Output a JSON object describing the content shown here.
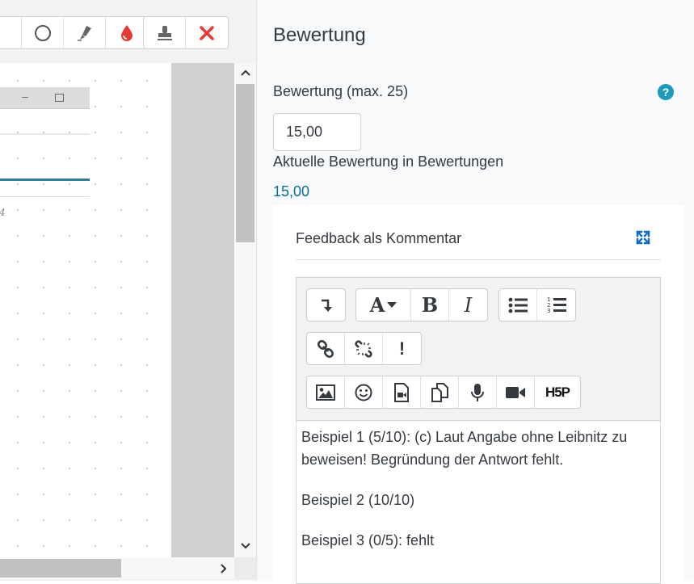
{
  "annotation_toolbar": {
    "group_a": [
      {
        "name": "partial-tool",
        "icon": "partial-icon"
      },
      {
        "name": "oval-tool",
        "icon": "circle-icon"
      },
      {
        "name": "pen-tool",
        "icon": "pen-icon"
      },
      {
        "name": "color-tool",
        "icon": "color-drop-icon",
        "color": "#e53935"
      }
    ],
    "group_b": [
      {
        "name": "stamp-tool",
        "icon": "stamp-icon"
      },
      {
        "name": "cross-stamp",
        "icon": "red-cross-icon",
        "color": "#e53935"
      }
    ]
  },
  "grading": {
    "heading": "Bewertung",
    "grade_label": "Bewertung (max. 25)",
    "grade_value": "15,00",
    "current_label": "Aktuelle Bewertung in Bewertungen",
    "current_value": "15,00",
    "help_icon": "?"
  },
  "feedback": {
    "title": "Feedback als Kommentar",
    "toolbar": {
      "row1": [
        {
          "name": "show-more-buttons",
          "icon": "arrow-turn-down-icon"
        },
        {
          "name": "font-style",
          "icon": "font-dropdown-icon",
          "label": "A"
        },
        {
          "name": "bold",
          "icon": "bold-icon",
          "label": "B"
        },
        {
          "name": "italic",
          "icon": "italic-icon",
          "label": "I"
        },
        {
          "name": "unordered-list",
          "icon": "bullet-list-icon"
        },
        {
          "name": "ordered-list",
          "icon": "numbered-list-icon"
        }
      ],
      "row2": [
        {
          "name": "link",
          "icon": "link-icon"
        },
        {
          "name": "unlink",
          "icon": "unlink-icon"
        },
        {
          "name": "accessibility-checker",
          "icon": "exclamation-icon",
          "label": "!"
        }
      ],
      "row3": [
        {
          "name": "insert-image",
          "icon": "image-icon"
        },
        {
          "name": "emoji",
          "icon": "smiley-icon"
        },
        {
          "name": "insert-media",
          "icon": "media-file-icon"
        },
        {
          "name": "manage-files",
          "icon": "files-icon"
        },
        {
          "name": "record-audio",
          "icon": "microphone-icon"
        },
        {
          "name": "record-video",
          "icon": "video-camera-icon"
        },
        {
          "name": "h5p",
          "icon": "h5p-icon",
          "label": "H5P"
        }
      ]
    },
    "paragraphs": [
      "Beispiel 1 (5/10): (c) Laut Angabe ohne Leibnitz zu beweisen! Begründung der Antwort fehlt.",
      "Beispiel 2 (10/10)",
      "Beispiel 3 (0/5): fehlt"
    ]
  },
  "pdf_preview": {
    "digit": "4"
  },
  "colors": {
    "accent_link": "#0a6d96",
    "help": "#1b9bb8",
    "expand": "#0f6cbf",
    "annotation_red": "#e53935"
  }
}
